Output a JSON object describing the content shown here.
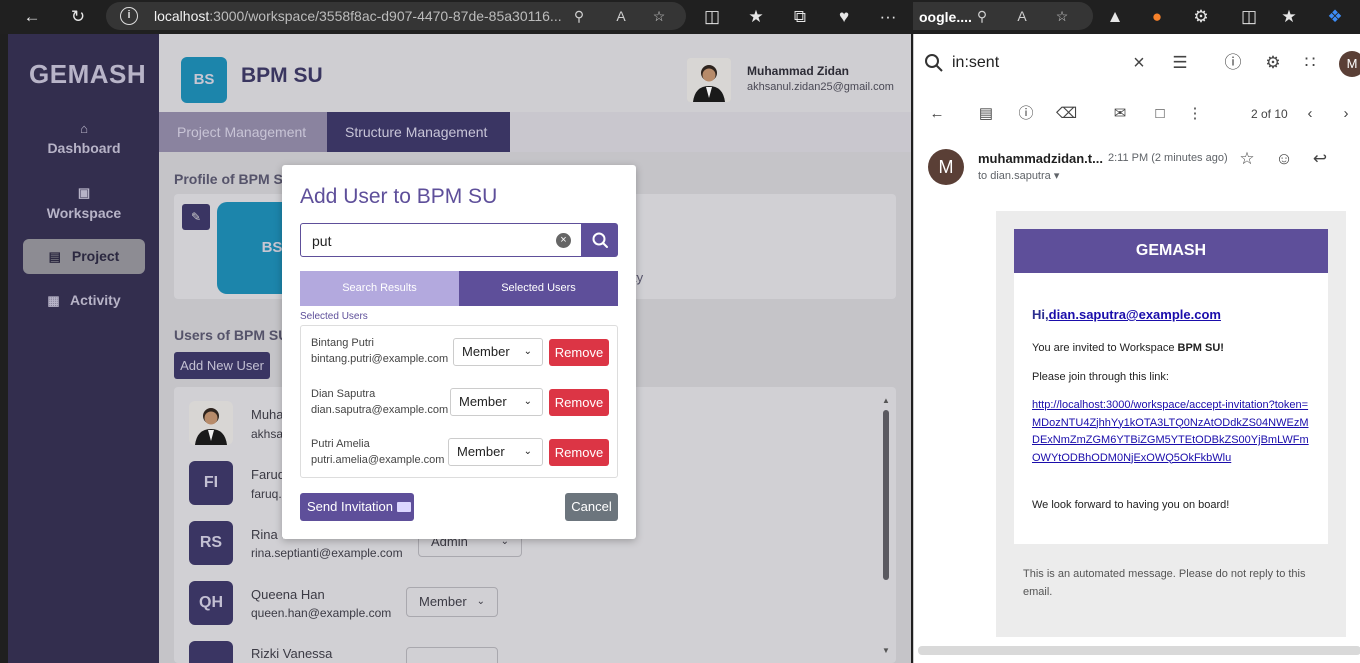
{
  "browser_left": {
    "url_host": "localhost",
    "url_rest": ":3000/workspace/3558f8ac-d907-4470-87de-85a30116..."
  },
  "browser_right": {
    "tab_text": "oogle...."
  },
  "sidebar": {
    "brand": "GEMASH",
    "items": [
      {
        "label": "Dashboard",
        "icon": "home-icon"
      },
      {
        "label": "Workspace",
        "icon": "briefcase-icon"
      },
      {
        "label": "Project",
        "icon": "ticket-icon"
      },
      {
        "label": "Activity",
        "icon": "calendar-icon"
      }
    ]
  },
  "header": {
    "logo_initials": "BS",
    "workspace_title": "BPM SU",
    "user_name": "Muhammad Zidan",
    "user_email": "akhsanul.zidan25@gmail.com"
  },
  "tabs": [
    "Project Management",
    "Structure Management"
  ],
  "profile": {
    "title": "Profile of BPM SU",
    "logo_initials": "BS",
    "partial_text": "ty"
  },
  "members": {
    "title": "Users of BPM SU",
    "add_button": "Add New User",
    "rows": [
      {
        "initials": "",
        "name": "Muha",
        "email": "akhsa",
        "role": ""
      },
      {
        "initials": "FI",
        "name": "Faruq",
        "email": "faruq.",
        "role": ""
      },
      {
        "initials": "RS",
        "name": "Rina S",
        "email": "rina.septianti@example.com",
        "role": "Admin"
      },
      {
        "initials": "QH",
        "name": "Queena Han",
        "email": "queen.han@example.com",
        "role": "Member"
      },
      {
        "initials": "",
        "name": "Rizki Vanessa",
        "email": "",
        "role": ""
      }
    ]
  },
  "modal": {
    "title": "Add User to BPM SU",
    "search_value": "put",
    "toggle_left": "Search Results",
    "toggle_right": "Selected Users",
    "selected_label": "Selected Users",
    "selected": [
      {
        "name": "Bintang Putri",
        "email": "bintang.putri@example.com",
        "role": "Member",
        "remove": "Remove"
      },
      {
        "name": "Dian Saputra",
        "email": "dian.saputra@example.com",
        "role": "Member",
        "remove": "Remove"
      },
      {
        "name": "Putri Amelia",
        "email": "putri.amelia@example.com",
        "role": "Member",
        "remove": "Remove"
      }
    ],
    "send_button": "Send Invitation",
    "cancel_button": "Cancel"
  },
  "gmail": {
    "query": "in:sent",
    "count": "2 of 10",
    "sender_initial": "M",
    "account_initial": "M",
    "from": "muhammadzidan.t...",
    "time": "2:11 PM (2 minutes ago)",
    "to": "to dian.saputra",
    "email": {
      "brand": "GEMASH",
      "greeting": "Hi,",
      "greeting_email": "dian.saputra@example.com",
      "line1_prefix": "You are invited to Workspace ",
      "line1_bold": "BPM SU!",
      "line2": "Please join through this link:",
      "link": "http://localhost:3000/workspace/accept-invitation?token=MDozNTU4ZjhhYy1kOTA3LTQ0NzAtODdkZS04NWEzMDExNmZmZGM6YTBiZGM5YTEtODBkZS00YjBmLWFmOWYtODBhODM0NjExOWQ5OkFkbWlu",
      "closing": "We look forward to having you on board!",
      "footer": "This is an automated message. Please do not reply to this email."
    }
  }
}
